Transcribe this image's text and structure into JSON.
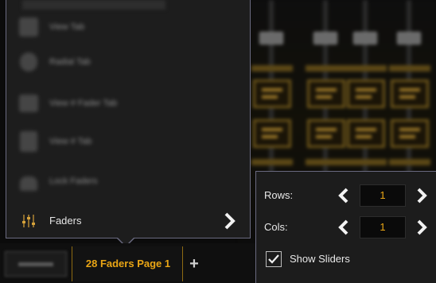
{
  "menu": {
    "blurred_items": [
      {
        "icon": "tile-view-icon",
        "label": "View Tab"
      },
      {
        "icon": "radial-icon",
        "label": "Radial Tab"
      },
      {
        "icon": "grid-view-icon",
        "label": "View # Fader Tab"
      },
      {
        "icon": "list-view-icon",
        "label": "View # Tab"
      },
      {
        "icon": "lock-icon",
        "label": "Lock Faders"
      }
    ],
    "faders_item": {
      "icon": "faders-icon",
      "label": "Faders"
    }
  },
  "tabs": {
    "active_label": "28 Faders Page 1",
    "add_label": "+"
  },
  "submenu": {
    "rows_label": "Rows:",
    "rows_value": "1",
    "cols_label": "Cols:",
    "cols_value": "1",
    "show_sliders_label": "Show Sliders",
    "show_sliders_checked": true
  },
  "colors": {
    "accent": "#e9a515",
    "panel": "#1d1d1d",
    "border": "#6a6a80"
  }
}
